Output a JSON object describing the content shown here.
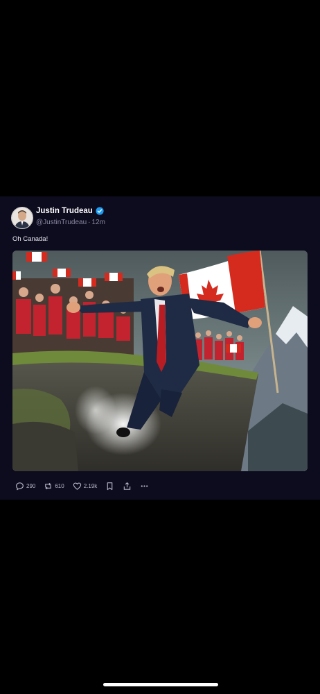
{
  "post": {
    "author": {
      "display_name": "Justin Trudeau",
      "handle": "@JustinTrudeau",
      "separator": "·",
      "time": "12m",
      "verified": true
    },
    "text": "Oh Canada!",
    "image_icon": "photo",
    "actions": {
      "reply_count": "290",
      "repost_count": "610",
      "like_count": "2.19k"
    }
  },
  "icons": {
    "reply": "speech-bubble",
    "repost": "repost-arrows",
    "like": "heart",
    "bookmark": "bookmark",
    "share": "share-up-arrow",
    "more": "ellipsis"
  },
  "colors": {
    "card_bg": "#0d0b1e",
    "verified": "#1d9bf0",
    "canada_red": "#d52b1e"
  }
}
